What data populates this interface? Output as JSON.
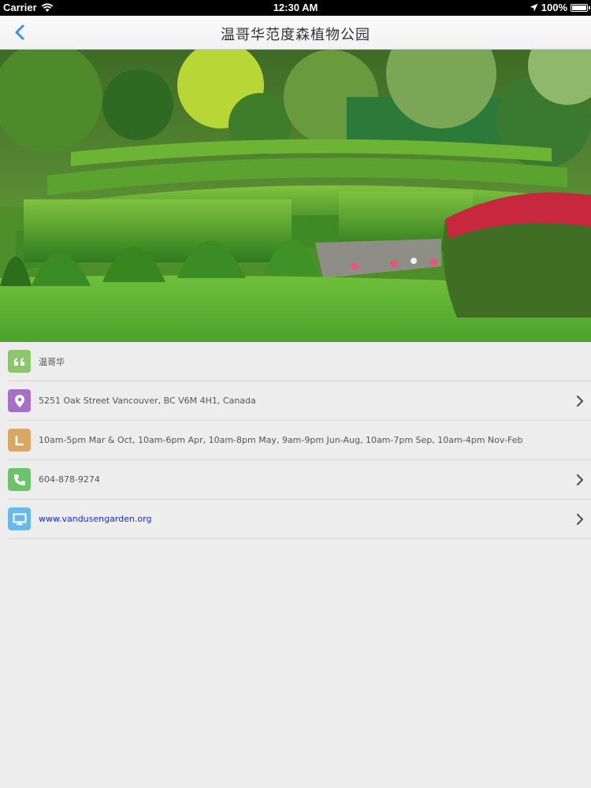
{
  "status_bar": {
    "carrier": "Carrier",
    "time": "12:30 AM",
    "battery": "100%"
  },
  "nav": {
    "title": "温哥华范度森植物公园",
    "back_icon": "chevron-left-icon"
  },
  "hero": {
    "description_icon": "photo"
  },
  "info": {
    "rows": [
      {
        "icon": "quote-icon",
        "color": "#8cc66f",
        "text": "温哥华",
        "has_chevron": false
      },
      {
        "icon": "location-pin-icon",
        "color": "#a770c4",
        "text": "5251 Oak Street Vancouver, BC V6M 4H1, Canada",
        "has_chevron": true
      },
      {
        "icon": "clock-icon",
        "color": "#d9a865",
        "text": "10am-5pm Mar & Oct, 10am-6pm Apr, 10am-8pm May, 9am-9pm Jun-Aug, 10am-7pm Sep, 10am-4pm Nov-Feb",
        "has_chevron": false
      },
      {
        "icon": "phone-icon",
        "color": "#6cc36c",
        "text": "604-878-9274",
        "has_chevron": true
      },
      {
        "icon": "monitor-icon",
        "color": "#6ab8ea",
        "text": "www.vandusengarden.org",
        "has_chevron": true
      }
    ]
  }
}
